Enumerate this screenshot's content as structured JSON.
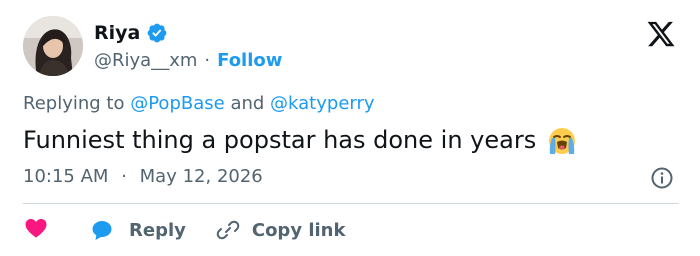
{
  "author": {
    "name": "Riya",
    "handle": "@Riya__xm",
    "separator": "·",
    "follow_label": "Follow",
    "verified_color": "#1d9bf0"
  },
  "replying": {
    "prefix": "Replying to",
    "mention_1": "@PopBase",
    "conjunction": "and",
    "mention_2": "@katyperry"
  },
  "tweet": {
    "text": "Funniest thing a popstar has done in years",
    "emoji": "loudly-crying-face"
  },
  "meta": {
    "time": "10:15 AM",
    "separator": "·",
    "date": "May 12, 2026"
  },
  "actions": {
    "reply_label": "Reply",
    "copy_link_label": "Copy link"
  },
  "colors": {
    "accent": "#1d9bf0",
    "like": "#f91880",
    "text": "#0f1419",
    "muted": "#536471"
  }
}
